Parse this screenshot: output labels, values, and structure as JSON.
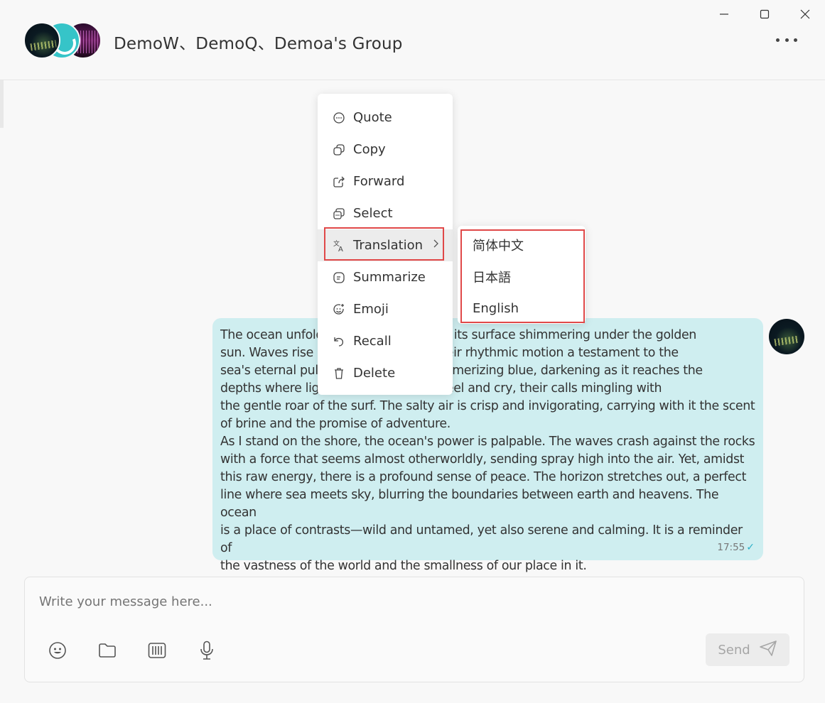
{
  "header": {
    "title": "DemoW、DemoQ、Demoa's Group",
    "more_icon": "ellipsis-icon"
  },
  "window_controls": {
    "minimize": "minimize-icon",
    "maximize": "maximize-icon",
    "close": "close-icon"
  },
  "message": {
    "text": "The ocean unfolds like a vast tapestry, its surface shimmering under the golden\nsun. Waves rise and fall in a dance, their rhythmic motion a testament to the\nsea's eternal pulse. The water is a mesmerizing blue, darkening as it reaches the\ndepths where light fades. Seagulls wheel and cry, their calls mingling with\nthe gentle roar of the surf. The salty air is crisp and invigorating, carrying with it the scent\nof brine and the promise of adventure.\nAs I stand on the shore, the ocean's power is palpable. The waves crash against the rocks\nwith a force that seems almost otherworldly, sending spray high into the air. Yet, amidst\nthis raw energy, there is a profound sense of peace. The horizon stretches out, a perfect\nline where sea meets sky, blurring the boundaries between earth and heavens. The ocean\nis a place of contrasts—wild and untamed, yet also serene and calming. It is a reminder of\nthe vastness of the world and the smallness of our place in it.",
    "time": "17:55",
    "status_icon": "check-icon",
    "bubble_color": "#cfeef0"
  },
  "context_menu": {
    "items": [
      {
        "label": "Quote",
        "icon": "quote-icon"
      },
      {
        "label": "Copy",
        "icon": "copy-icon"
      },
      {
        "label": "Forward",
        "icon": "forward-icon"
      },
      {
        "label": "Select",
        "icon": "select-icon"
      },
      {
        "label": "Translation",
        "icon": "translate-icon"
      },
      {
        "label": "Summarize",
        "icon": "summarize-icon"
      },
      {
        "label": "Emoji",
        "icon": "emoji-icon"
      },
      {
        "label": "Recall",
        "icon": "recall-icon"
      },
      {
        "label": "Delete",
        "icon": "delete-icon"
      }
    ]
  },
  "translation_submenu": {
    "items": [
      "简体中文",
      "日本語",
      "English"
    ]
  },
  "composer": {
    "placeholder": "Write your message here...",
    "send_label": "Send",
    "tools": [
      "emoji-icon",
      "folder-icon",
      "custom-message-icon",
      "microphone-icon"
    ]
  },
  "colors": {
    "highlight": "#e04848",
    "accent": "#2bb0c8"
  }
}
